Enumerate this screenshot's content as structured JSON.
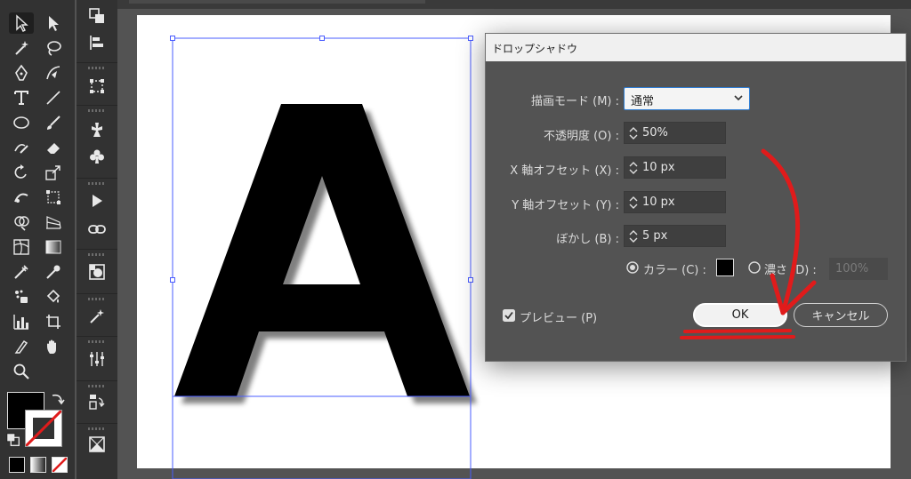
{
  "dialog": {
    "title": "ドロップシャドウ",
    "mode_label": "描画モード (M) :",
    "mode_value": "通常",
    "opacity_label": "不透明度 (O) :",
    "opacity_value": "50%",
    "x_offset_label": "X 軸オフセット (X) :",
    "x_offset_value": "10 px",
    "y_offset_label": "Y 軸オフセット (Y) :",
    "y_offset_value": "10 px",
    "blur_label": "ぼかし (B) :",
    "blur_value": "5 px",
    "color_label": "カラー (C) :",
    "color_value": "#000000",
    "darkness_label": "濃さ (D) :",
    "darkness_value": "100%",
    "preview_label": "プレビュー (P)",
    "ok_label": "OK",
    "cancel_label": "キャンセル"
  },
  "artwork": {
    "letter": "A",
    "fill": "#000000"
  },
  "colors": {
    "panel_bg": "#323232",
    "canvas_bg": "#535353",
    "selection": "#4a5cff",
    "annotation": "#e01b1b",
    "focus": "#2d7cd3"
  },
  "swatches": {
    "fill": "#000000",
    "stroke": "none"
  }
}
